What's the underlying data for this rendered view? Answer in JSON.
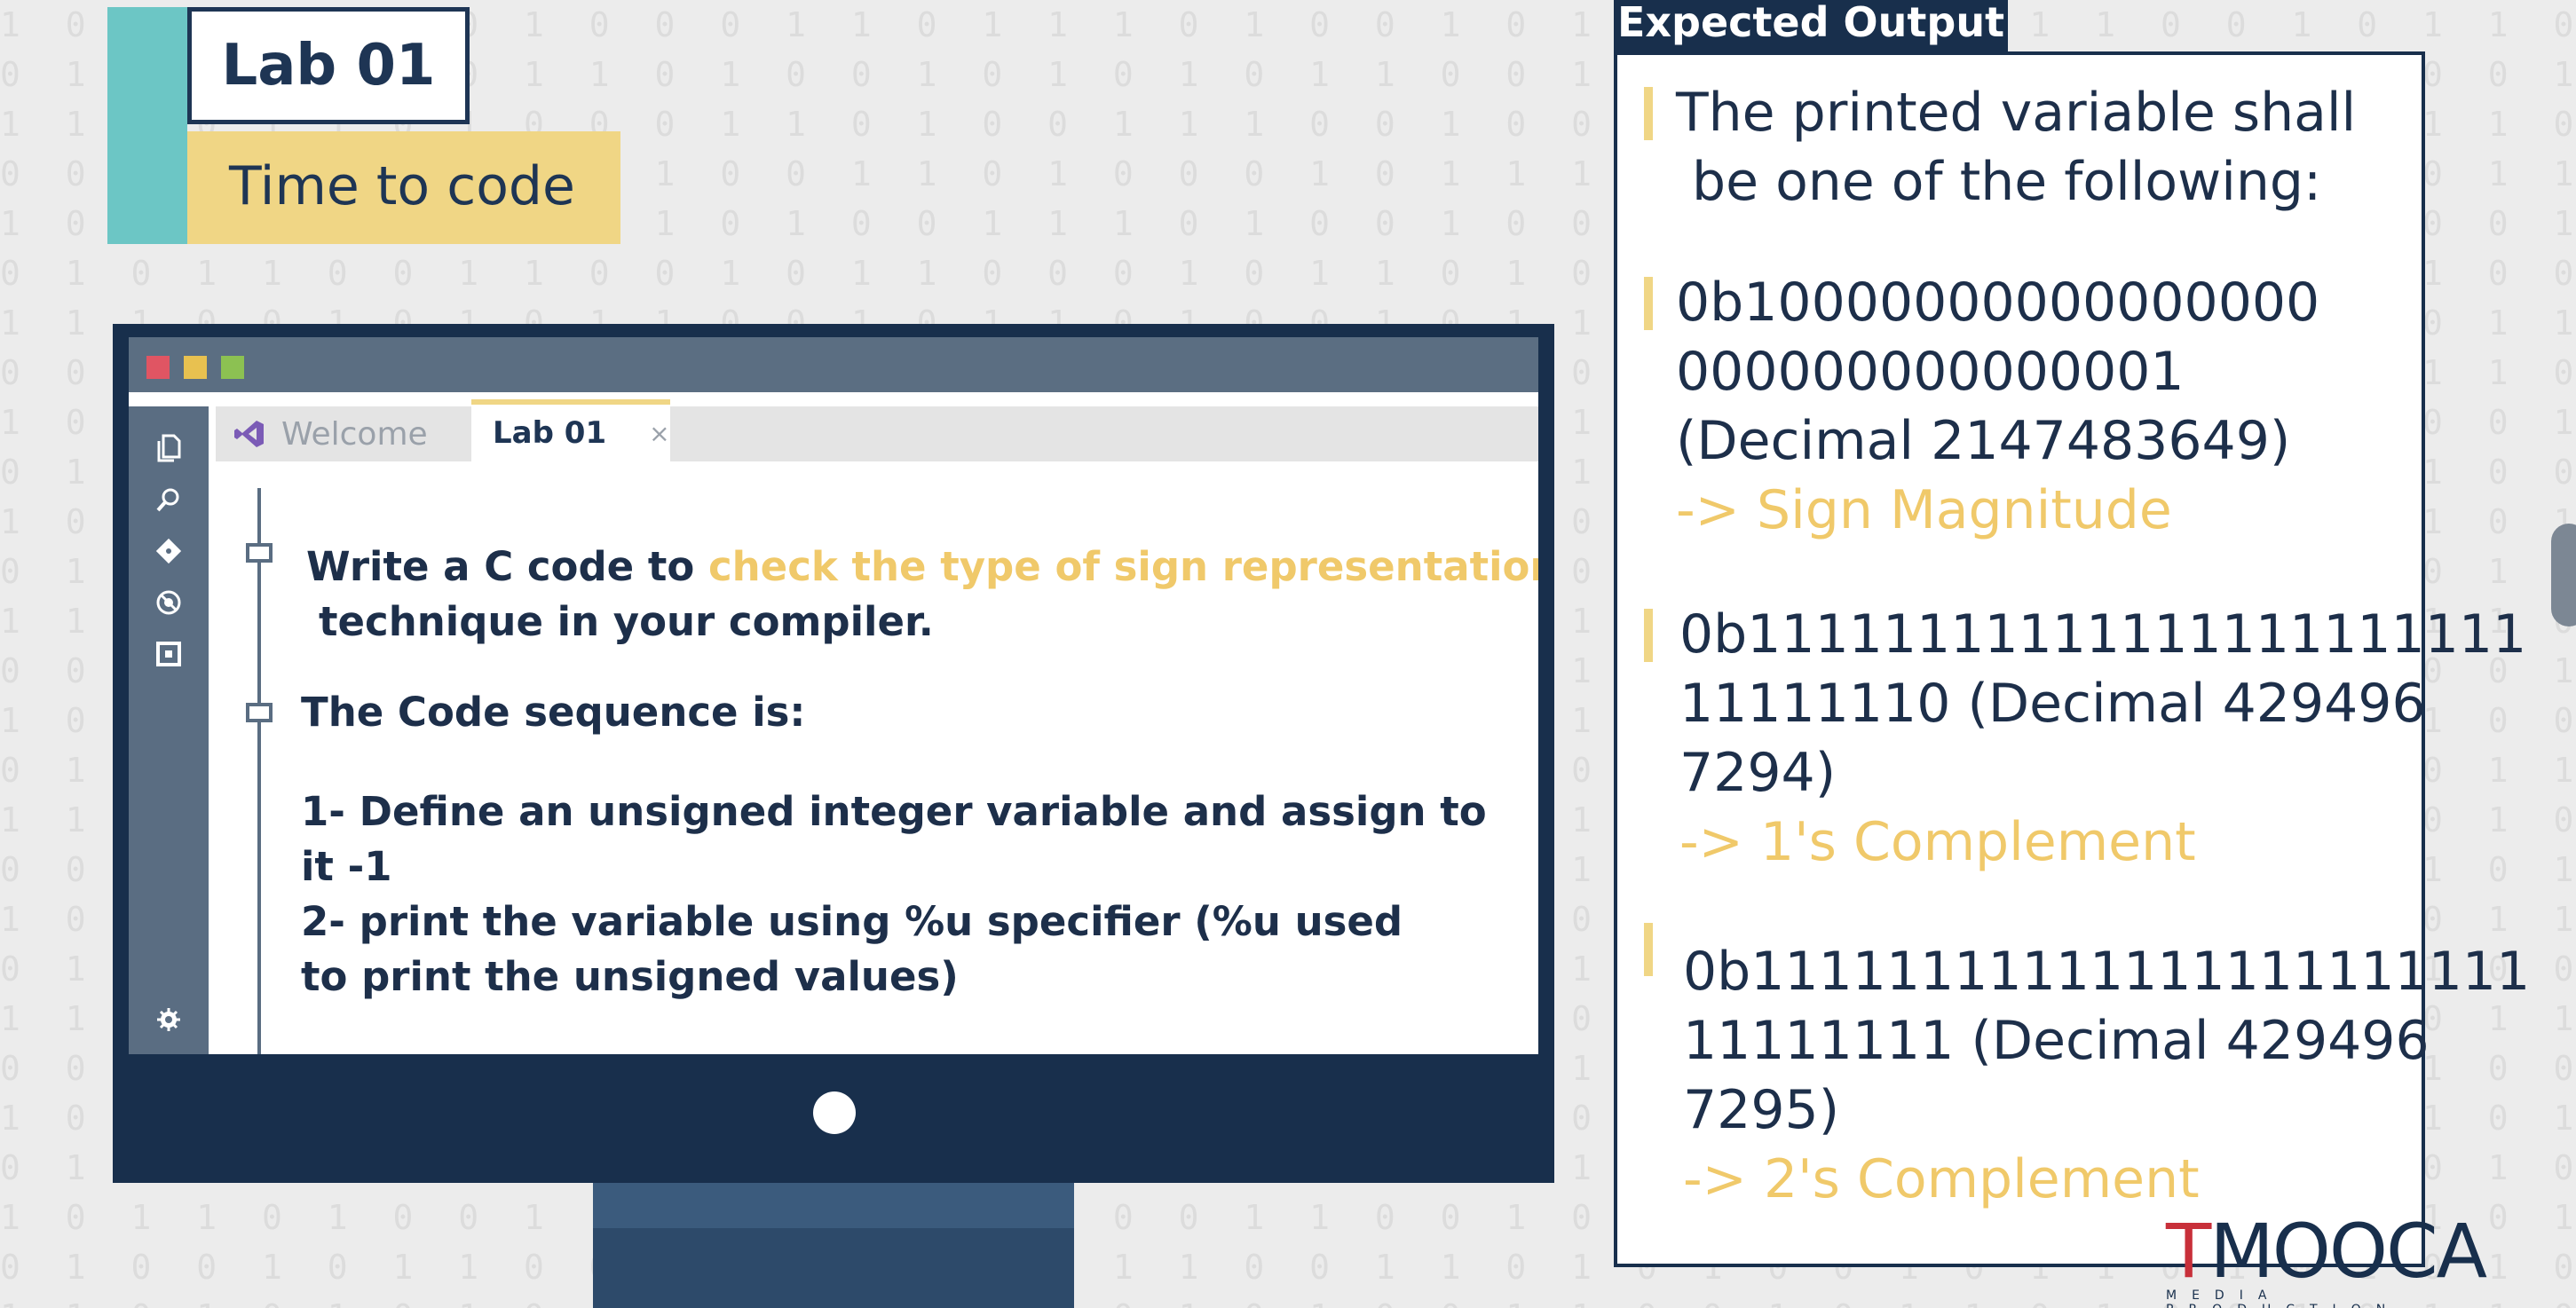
{
  "background_binary": [
    "1 0 0 1 0 0 1 0 1 0 0 0 1 1 0 1 1 1 0 1 0 0 1 0 1 0 0 1 1 0 1 1 1 0 0 1 0 1 1 0 1 1 1 0 0 1 1",
    "0 1 1 0 1 0 0 0 1 1 0 1 0 0 1 0 1 0 1 0 1 1 0 0 1 0 1 0 0 0 1 1 0 1 0 1 1 0 0 1 0 0 1 1 0 0",
    "1 1 0 0 1 1 0 1 0 0 0 1 1 0 1 0 0 1 1 1 0 0 1 0 0 0 1 0 1 1 0 0 1 0 1 0 0 1 1 0 1 0 0 1 1 0",
    "0 0 1 1 0 1 0 1 1 0 1 0 0 1 1 0 1 0 0 0 1 0 1 1 1 0 1 0 0 0 1 1 0 1 1 0 1 0 1 1 0 0 1 0 1 1",
    "1 0 1 0 0 1 1 0 0 1 1 0 1 0 0 1 1 1 0 1 0 0 1 0 0 1 1 1 0 0 1 0 1 1 0 1 1 0 0 1 0 1 1 1 0 0",
    "0 1 0 1 1 0 0 1 1 0 0 1 0 1 1 0 0 0 1 0 1 1 0 1 0 1 0 0 1 1 0 0 1 0 1 1 0 1 0 0 1 1 0 0 1 0",
    "1 1 1 0 0 1 0 1 0 1 1 0 0 1 0 1 1 0 1 0 0 1 0 1 1 0 0 1 0 1 1 1 0 1 0 0 1 0 1 1 0 0 1 1 0 1",
    "0 0 1 0 1 1 1 0 0 1 0 1 1 0 1 0 0 1 0 1 1 0 1 0 0 1 1 0 1 0 0 0 1 1 0 1 0 1 1 0 1 0 0 1 0 1",
    "1 0 0 1 1 0 1 0 1 0 0 1 1 1 0 0 1 0 1 0 1 1 0 0 1 0 1 1 0 0 1 1 0 0 1 0 1 0 0 1 1 0 1 0 1 0",
    "0 1 1 1 0 0 1 0 0 1 1 0 1 0 0 1 0 1 1 0 0 1 1 0 1 1 0 0 1 0 1 0 0 1 1 0 1 1 0 0 1 0 1 1 0 0",
    "1 0 1 0 1 0 0 1 1 0 1 0 0 1 1 0 1 0 0 1 1 0 0 1 0 1 0 1 1 0 0 1 1 0 1 0 0 1 0 1 1 0 0 1 1 0",
    "0 1 0 0 1 1 0 1 0 1 0 1 1 0 0 1 0 1 1 0 1 0 1 0 0 1 1 0 1 0 1 0 0 1 0 1 1 0 1 0 0 1 1 0 1 1",
    "1 1 0 1 0 0 1 0 1 1 0 0 1 0 1 0 1 0 0 1 0 1 1 0 1 0 0 1 0 1 0 1 1 0 1 0 0 1 1 0 1 0 0 1 0 0",
    "0 0 1 1 0 1 0 1 0 0 1 1 0 1 0 1 1 0 1 0 0 1 0 1 1 0 1 0 0 1 1 0 0 1 1 0 1 0 0 1 1 0 1 0 1 1",
    "1 0 1 0 1 1 0 0 1 0 1 0 1 1 0 0 1 1 0 1 0 0 1 0 1 1 0 0 1 0 1 1 0 0 1 0 1 1 0 0 1 0 1 1 0 0",
    "0 1 0 1 0 0 1 1 0 1 0 1 0 0 1 1 0 0 1 0 1 1 0 1 0 0 1 1 0 1 0 0 1 1 0 1 0 0 1 1 0 1 0 0 1 1",
    "1 1 0 0 1 0 1 0 1 1 0 0 1 0 1 0 1 1 0 0 1 0 1 0 1 1 0 1 0 0 1 0 1 0 1 1 0 0 1 0 1 0 1 1 0 0",
    "0 0 1 0 1 1 0 1 0 0 1 1 0 1 0 0 1 0 1 1 0 1 0 0 1 0 1 1 0 1 0 1 0 1 0 0 1 1 0 1 0 1 0 0 1 1",
    "1 0 1 1 0 0 1 0 1 0 0 1 1 0 1 1 0 1 0 0 1 0 1 1 0 1 0 0 1 0 1 0 1 1 0 0 1 0 1 1 0 1 0 0 1 0",
    "0 1 0 0 1 1 0 1 0 1 1 0 0 1 0 0 1 0 1 1 0 1 0 0 1 0 1 1 0 1 0 1 0 0 1 1 0 1 0 0 1 0 1 1 0 1",
    "1 1 1 0 0 1 0 0 1 0 1 1 0 0 1 1 0 1 0 0 1 1 0 1 0 1 0 0 1 1 0 0 1 0 1 1 0 0 1 1 0 1 0 0 1 0",
    "0 0 1 1 0 0 1 1 0 1 0 0 1 1 0 0 1 0 1 1 0 0 1 0 1 0 1 1 0 0 1 1 0 1 0 0 1 1 0 0 1 0 1 1 0 1",
    "1 0 0 1 1 0 0 1 1 0 1 0 0 1 1 0 1 1 0 0 1 0 1 1 0 1 0 0 1 1 0 1 0 1 1 0 0 1 0 1 1 0 0 1 1 0",
    "0 1 1 0 0 1 1 0 0 1 0 1 1 0 0 1 0 0 1 1 0 1 0 0 1 0 1 1 0 0 1 0 1 0 0 1 1 0 1 0 0 1 1 0 0 1",
    "1 0 1 1 0 1 0 0 1 1 0 1 0 1 1 0 1 0 0 1 1 0 0 1 0 1 0 1 1 0 1 0 0 1 0 1 0 1 0 1 1 0 1 0 1 1",
    "0 1 0 0 1 0 1 1 0 0 1 0 1 0 0 1 0 1 1 0 0 1 1 0 1 0 1 0 0 1 0 1 1 0 1 0 1 0 1 0 0 1 0 1 0 0",
    "1 1 0 1 0 1 0 1 0 1 1 0 0 1 0 1 1 0 1 0 1 0 0 1 1 0 0 1 0 1 1 0 1 0 0 1 0 1 1 0 1 0 1 0 0 1"
  ],
  "title": {
    "lab": "Lab 01",
    "subtitle": "Time to code"
  },
  "editor": {
    "window_dots": [
      "#e05563",
      "#e8c150",
      "#8cc152"
    ],
    "tabs": [
      {
        "label": "Welcome",
        "icon": "visual-studio-icon"
      },
      {
        "label": "Lab 01",
        "close": "×"
      }
    ],
    "sidebar_icons": [
      "files-icon",
      "search-icon",
      "git-icon",
      "debug-icon",
      "extensions-icon",
      "settings-icon"
    ],
    "intro_prefix": "Write a C code to ",
    "intro_highlight": "check the type of sign representation",
    "intro_suffix": "technique in your compiler.",
    "sequence_heading": "The Code sequence is:",
    "steps": [
      "1- Define an unsigned integer variable and assign to",
      "it -1",
      "2- print the variable using %u specifier (%u used",
      "to print the unsigned values)"
    ]
  },
  "expected_output": {
    "tab_label": "Expected Output",
    "intro_line1": "The printed variable shall",
    "intro_line2": "be one of the following:",
    "options": [
      {
        "lines": [
          "0b10000000000000000",
          "000000000000001",
          "(Decimal 2147483649)"
        ],
        "result": "-> Sign Magnitude"
      },
      {
        "lines": [
          "0b11111111111111111111111",
          "11111110 (Decimal 429496",
          "7294)"
        ],
        "result": "-> 1's Complement"
      },
      {
        "lines": [
          "0b11111111111111111111111",
          "11111111 (Decimal 429496",
          "7295)"
        ],
        "result": "-> 2's Complement"
      }
    ]
  },
  "logo": {
    "mark": "T",
    "name": "MOOCA",
    "tagline": "MEDIA PRODUCTION"
  },
  "colors": {
    "navy": "#182f4c",
    "teal": "#6cc6c5",
    "yellow": "#f0d685",
    "highlight": "#f0c96a",
    "logo_red": "#c8303a"
  }
}
